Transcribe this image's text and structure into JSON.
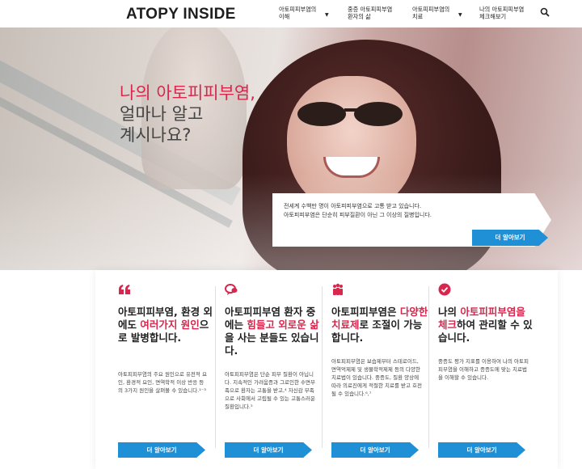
{
  "header": {
    "logo": "ATOPY INSIDE",
    "nav": [
      {
        "l1": "아토피피부염의",
        "l2": "이해"
      },
      {
        "l1": "중증 아토피피부염",
        "l2": "환자의 삶"
      },
      {
        "l1": "아토피피부염의",
        "l2": "치료"
      },
      {
        "l1": "나의 아토피피부염",
        "l2": "체크해보기"
      }
    ]
  },
  "hero": {
    "title_accent": "나의 아토피피부염,",
    "title_line2": "얼마나 알고",
    "title_line3": "계시나요?",
    "box_line1": "전세계 수백만 명이 아토피피부염으로 고통 받고 있습니다.",
    "box_line2": "아토피피부염은 단순히 피부질환이 아닌 그 이상의 질병입니다.",
    "button": "더 알아보기"
  },
  "cards": [
    {
      "icon": "quote-icon",
      "title_pre": "아토피피부염, 환경 외에도 ",
      "title_accent": "여러가지 원인",
      "title_post": "으로 발병합니다.",
      "desc": "아토피피부염의 주요 원인으로 유전적 요인, 환경적 요인, 면역학적 이상 반응 등의 3가지 원인을 살펴볼 수 있습니다.¹⁻³",
      "button": "더 알아보기"
    },
    {
      "icon": "chat-bubbles-icon",
      "title_pre": "아토피피부염 환자 중에는 ",
      "title_accent": "힘들고 외로운 삶",
      "title_post": "을 사는 분들도 있습니다.",
      "desc": "아토피피부염은 단순 피부 질환이 아닙니다. 지속적인 가려움증과 그로인한 수면부족으로 환자는 고통을 받고,⁴ 자신감 부족으로 사회에서 고립될 수 있는 고통스러운 질환입니다.⁵",
      "button": "더 알아보기"
    },
    {
      "icon": "people-icon",
      "title_pre": "아토피피부염은 ",
      "title_accent": "다양한 치료제",
      "title_post": "로 조절이 가능합니다.",
      "desc": "아토피피부염은 보습제부터 스테로이드, 면역억제제 및 생물학적제제 등의 다양한 치료법이 있습니다. 중증도, 질환 양상에 따라 의료진에게 적절한 치료를 받고 호전될 수 있습니다.⁶,⁷",
      "button": "더 알아보기"
    },
    {
      "icon": "check-circle-icon",
      "title_pre": "나의 ",
      "title_accent": "아토피피부염을 체크",
      "title_post": "하여 관리할 수 있습니다.",
      "desc": "중증도 평가 지표를 이용하여 나의 아토피피부염을 이해하고 증증도에 맞는 치료법을 이해할 수 있습니다.",
      "button": "더 알아보기"
    }
  ],
  "colors": {
    "accent": "#d8264c",
    "button": "#1f8fd6"
  }
}
